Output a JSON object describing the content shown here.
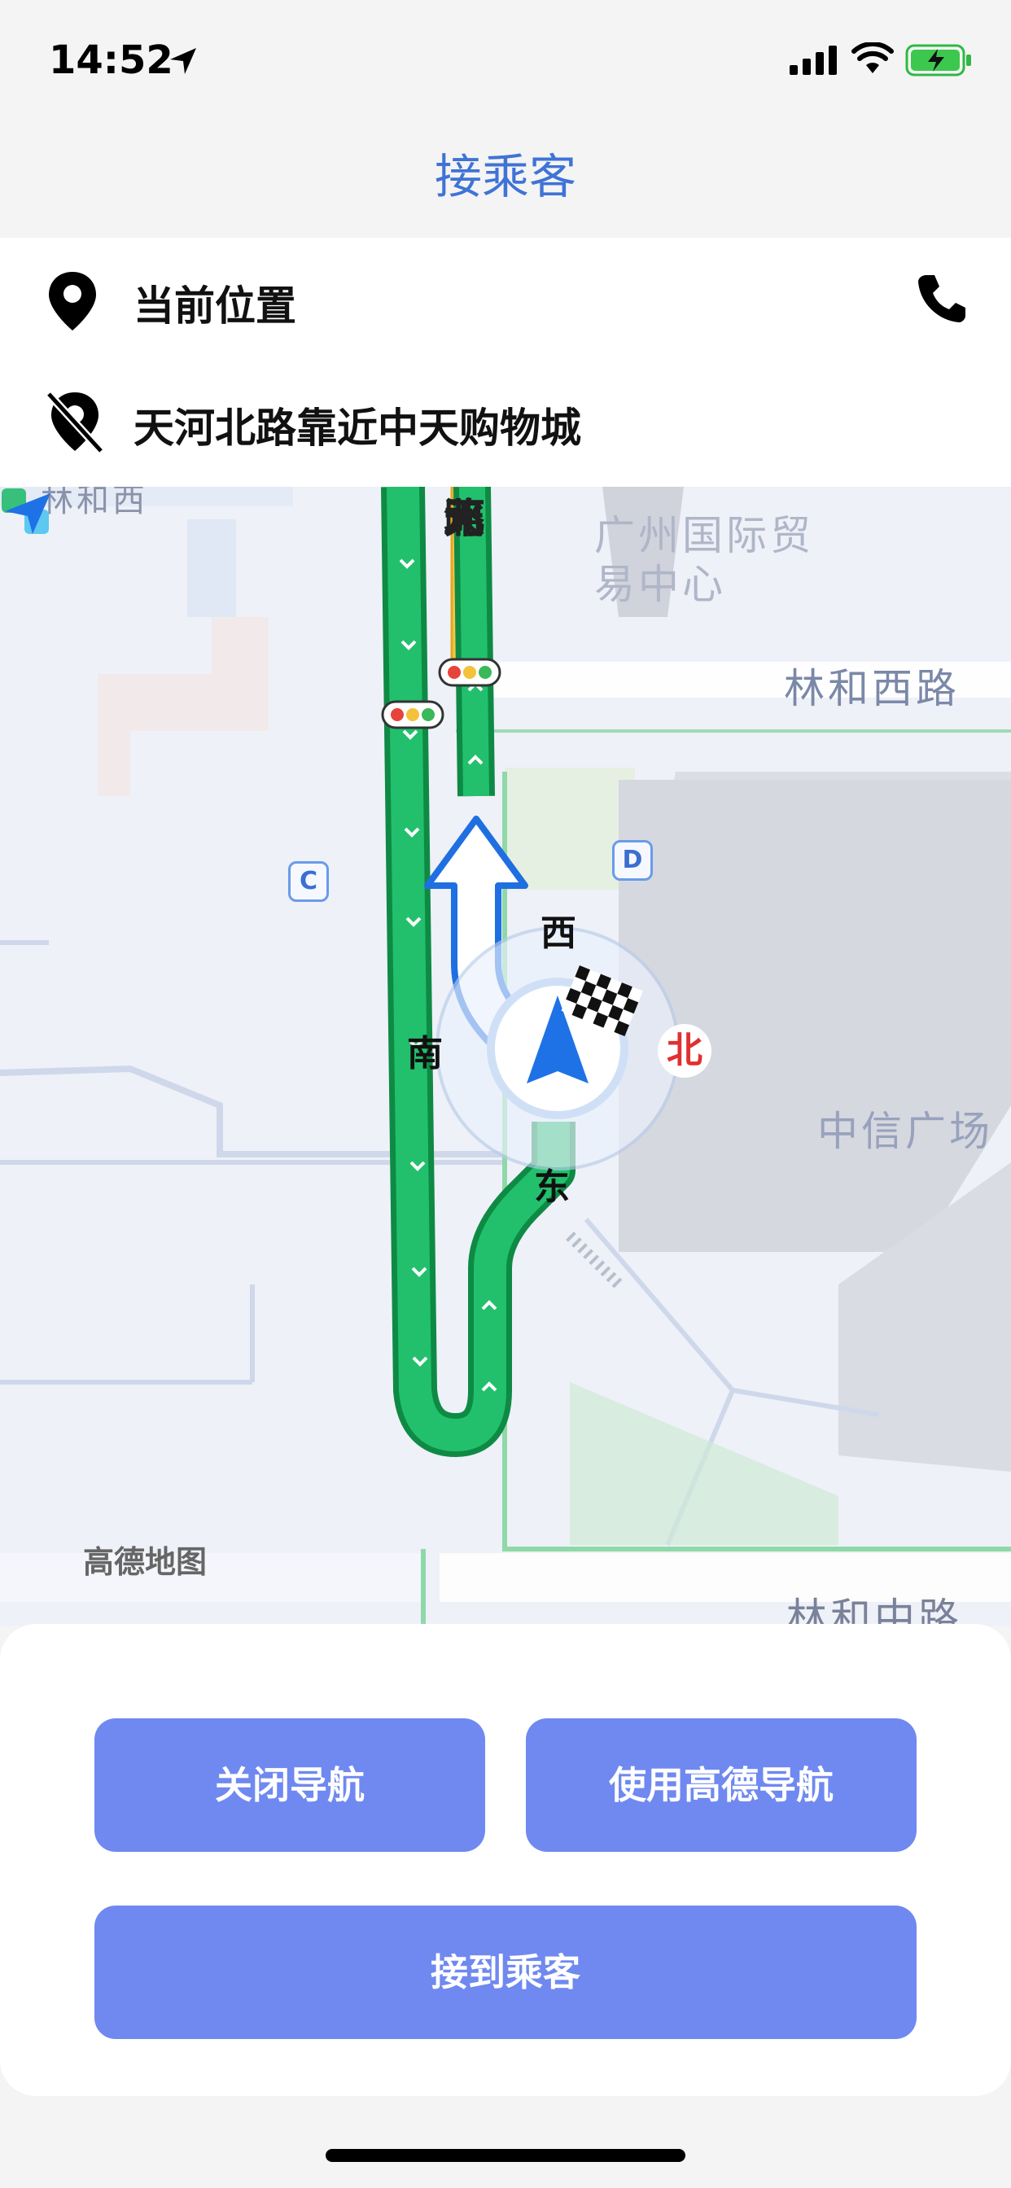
{
  "status": {
    "time": "14:52",
    "location_icon": "location-arrow-icon",
    "signal_icon": "cell-signal-icon",
    "wifi_icon": "wifi-icon",
    "battery_icon": "battery-charging-icon"
  },
  "header": {
    "title": "接乘客"
  },
  "locations": {
    "current": {
      "label": "当前位置",
      "icon": "location-pin-icon"
    },
    "destination": {
      "label": "天河北路靠近中天购物城",
      "icon": "location-pin-off-icon"
    },
    "phone_icon": "phone-icon"
  },
  "map": {
    "labels": {
      "top_left": "林和西",
      "building_top": "广州国际贸易中心",
      "road_right": "林和西路",
      "road_vertical": [
        "天",
        "河",
        "北",
        "路"
      ],
      "building_right": "中信广场",
      "road_bottom": "林和中路"
    },
    "compass": {
      "west": "西",
      "south": "南",
      "east": "东",
      "north": "北"
    },
    "badges": {
      "c": "C",
      "d": "D"
    },
    "brand": "高德地图"
  },
  "actions": {
    "close_nav": "关闭导航",
    "use_amap": "使用高德导航",
    "picked_up": "接到乘客"
  },
  "colors": {
    "accent": "#3f73d6",
    "button": "#6f89f0",
    "route": "#1fb865"
  }
}
